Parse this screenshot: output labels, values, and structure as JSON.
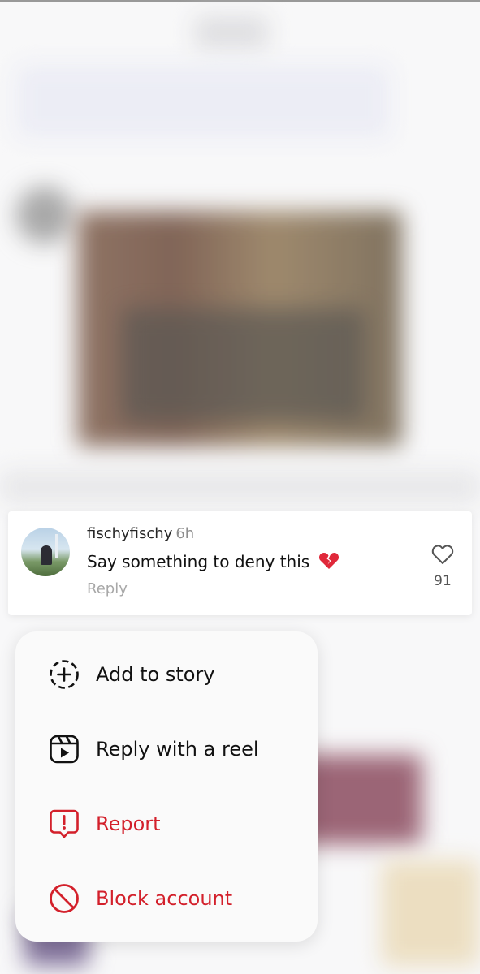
{
  "comment": {
    "username": "fischyfischy",
    "time": "6h",
    "text": "Say something to deny this",
    "emoji": "broken-heart-emoji",
    "reply_label": "Reply",
    "like_count": "91"
  },
  "menu": {
    "items": [
      {
        "label": "Add to story",
        "icon": "add-to-story-icon",
        "danger": false
      },
      {
        "label": "Reply with a reel",
        "icon": "reel-icon",
        "danger": false
      },
      {
        "label": "Report",
        "icon": "report-icon",
        "danger": true
      },
      {
        "label": "Block account",
        "icon": "block-icon",
        "danger": true
      }
    ]
  },
  "colors": {
    "danger": "#d3202b",
    "text": "#111111",
    "muted": "#a8a8a8"
  }
}
